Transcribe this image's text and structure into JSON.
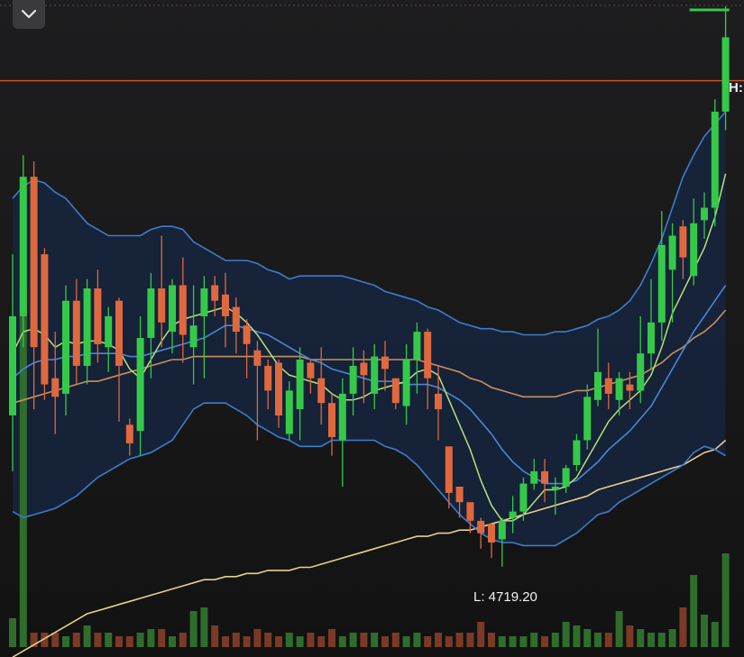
{
  "toolbar": {
    "collapse_icon": "chevron-down-icon"
  },
  "colors": {
    "up": "#35c94a",
    "down": "#e0683e",
    "band_fill": "#16243b",
    "band_outer": "#3d7ccf",
    "mid_band": "#4a86d8",
    "ma_fast": "#b9e07a",
    "ma_slow": "#c8915c",
    "ma_long": "#e8cf8a",
    "resistance_line": "#d0572c",
    "volume_up": "#2f6d2c",
    "volume_down": "#7a3a26"
  },
  "chart_data": {
    "type": "candlestick",
    "x": [
      0,
      1,
      2,
      3,
      4,
      5,
      6,
      7,
      8,
      9,
      10,
      11,
      12,
      13,
      14,
      15,
      16,
      17,
      18,
      19,
      20,
      21,
      22,
      23,
      24,
      25,
      26,
      27,
      28,
      29,
      30,
      31,
      32,
      33,
      34,
      35,
      36,
      37,
      38,
      39,
      40,
      41,
      42,
      43,
      44,
      45,
      46,
      47,
      48,
      49,
      50,
      51,
      52,
      53,
      54,
      55,
      56,
      57,
      58,
      59,
      60,
      61,
      62,
      63,
      64,
      65,
      66,
      67
    ],
    "ohlc": [
      [
        4768,
        4820,
        4750,
        4800
      ],
      [
        4800,
        4852,
        4790,
        4845
      ],
      [
        4845,
        4850,
        4770,
        4790
      ],
      [
        4820,
        4822,
        4773,
        4778
      ],
      [
        4780,
        4795,
        4762,
        4774
      ],
      [
        4775,
        4810,
        4768,
        4805
      ],
      [
        4805,
        4812,
        4778,
        4784
      ],
      [
        4784,
        4812,
        4778,
        4809
      ],
      [
        4809,
        4815,
        4785,
        4791
      ],
      [
        4790,
        4803,
        4782,
        4800
      ],
      [
        4805,
        4806,
        4766,
        4784
      ],
      [
        4765,
        4767,
        4755,
        4759
      ],
      [
        4763,
        4800,
        4755,
        4793
      ],
      [
        4793,
        4814,
        4780,
        4809
      ],
      [
        4809,
        4826,
        4790,
        4798
      ],
      [
        4795,
        4812,
        4788,
        4810
      ],
      [
        4810,
        4819,
        4785,
        4794
      ],
      [
        4790,
        4810,
        4778,
        4797
      ],
      [
        4800,
        4813,
        4780,
        4809
      ],
      [
        4810,
        4813,
        4800,
        4805
      ],
      [
        4807,
        4814,
        4790,
        4800
      ],
      [
        4803,
        4806,
        4788,
        4795
      ],
      [
        4797,
        4799,
        4780,
        4791
      ],
      [
        4789,
        4792,
        4760,
        4784
      ],
      [
        4784,
        4786,
        4770,
        4776
      ],
      [
        4785,
        4786,
        4764,
        4768
      ],
      [
        4762,
        4779,
        4760,
        4776
      ],
      [
        4770,
        4790,
        4760,
        4786
      ],
      [
        4785,
        4786,
        4775,
        4780
      ],
      [
        4780,
        4790,
        4765,
        4772
      ],
      [
        4772,
        4775,
        4755,
        4761
      ],
      [
        4760,
        4780,
        4745,
        4775
      ],
      [
        4775,
        4790,
        4768,
        4784
      ],
      [
        4785,
        4789,
        4772,
        4781
      ],
      [
        4775,
        4791,
        4770,
        4787
      ],
      [
        4787,
        4792,
        4776,
        4783
      ],
      [
        4780,
        4780,
        4770,
        4772
      ],
      [
        4771,
        4791,
        4765,
        4786
      ],
      [
        4786,
        4798,
        4775,
        4795
      ],
      [
        4795,
        4796,
        4770,
        4780
      ],
      [
        4775,
        4784,
        4760,
        4770
      ],
      [
        4758,
        4758,
        4738,
        4743
      ],
      [
        4745,
        4745,
        4735,
        4740
      ],
      [
        4740,
        4740,
        4730,
        4734
      ],
      [
        4734,
        4735,
        4725,
        4730
      ],
      [
        4733,
        4733,
        4722,
        4727
      ],
      [
        4728,
        4735,
        4719.2,
        4734
      ],
      [
        4735,
        4742,
        4730,
        4737
      ],
      [
        4737,
        4748,
        4734,
        4746
      ],
      [
        4746,
        4754,
        4744,
        4750
      ],
      [
        4750,
        4754,
        4740,
        4746
      ],
      [
        4744,
        4748,
        4736,
        4745
      ],
      [
        4745,
        4752,
        4743,
        4751
      ],
      [
        4752,
        4762,
        4750,
        4760
      ],
      [
        4760,
        4778,
        4757,
        4774
      ],
      [
        4773,
        4796,
        4771,
        4782
      ],
      [
        4780,
        4785,
        4770,
        4775
      ],
      [
        4773,
        4782,
        4768,
        4780
      ],
      [
        4778,
        4782,
        4770,
        4776
      ],
      [
        4776,
        4800,
        4772,
        4788
      ],
      [
        4788,
        4812,
        4783,
        4798
      ],
      [
        4798,
        4834,
        4792,
        4823
      ],
      [
        4815,
        4830,
        4798,
        4826
      ],
      [
        4829,
        4831,
        4812,
        4819
      ],
      [
        4813,
        4838,
        4810,
        4830
      ],
      [
        4831,
        4840,
        4825,
        4835
      ],
      [
        4835,
        4870,
        4829,
        4866
      ],
      [
        4866,
        4900,
        4860,
        4890
      ]
    ],
    "volume": [
      8,
      100,
      4,
      4,
      4,
      3,
      4,
      6,
      4,
      4,
      3,
      3,
      4,
      5,
      5,
      3,
      4,
      10,
      11,
      6,
      3,
      4,
      3,
      5,
      4,
      3,
      4,
      3,
      4,
      3,
      5,
      3,
      4,
      4,
      4,
      3,
      4,
      3,
      4,
      3,
      4,
      3,
      4,
      4,
      7,
      4,
      3,
      3,
      3,
      4,
      3,
      4,
      7,
      6,
      5,
      4,
      4,
      10,
      6,
      5,
      4,
      4,
      5,
      11,
      20,
      9,
      7,
      26
    ],
    "ma_fast": [
      4788,
      4795,
      4796,
      4794,
      4790,
      4792,
      4791,
      4792,
      4792,
      4791,
      4789,
      4783,
      4780,
      4786,
      4792,
      4797,
      4799,
      4800,
      4801,
      4802,
      4803,
      4801,
      4798,
      4794,
      4789,
      4784,
      4781,
      4780,
      4779,
      4778,
      4775,
      4773,
      4773,
      4774,
      4776,
      4777,
      4778,
      4779,
      4782,
      4783,
      4781,
      4773,
      4765,
      4757,
      4747,
      4739,
      4734,
      4734,
      4736,
      4740,
      4744,
      4744,
      4745,
      4748,
      4754,
      4760,
      4766,
      4770,
      4773,
      4776,
      4781,
      4790,
      4801,
      4808,
      4815,
      4822,
      4832,
      4846
    ],
    "mid_band": [
      4780,
      4783,
      4785,
      4786,
      4786,
      4787,
      4787,
      4788,
      4788,
      4788,
      4788,
      4787,
      4787,
      4788,
      4789,
      4790,
      4791,
      4792,
      4793,
      4795,
      4797,
      4797,
      4796,
      4795,
      4794,
      4792,
      4790,
      4788,
      4786,
      4785,
      4783,
      4782,
      4781,
      4780,
      4779,
      4779,
      4779,
      4778,
      4778,
      4778,
      4777,
      4775,
      4773,
      4770,
      4766,
      4762,
      4757,
      4753,
      4750,
      4748,
      4746,
      4746,
      4746,
      4747,
      4750,
      4753,
      4757,
      4760,
      4763,
      4767,
      4771,
      4777,
      4783,
      4789,
      4795,
      4800,
      4805,
      4810
    ],
    "band_upper": [
      4838,
      4842,
      4844,
      4843,
      4840,
      4838,
      4834,
      4830,
      4828,
      4826,
      4826,
      4826,
      4826,
      4828,
      4829,
      4829,
      4828,
      4824,
      4822,
      4820,
      4818,
      4818,
      4818,
      4817,
      4815,
      4814,
      4812,
      4813,
      4813,
      4813,
      4813,
      4813,
      4812,
      4811,
      4810,
      4808,
      4807,
      4806,
      4805,
      4803,
      4802,
      4800,
      4798,
      4797,
      4796,
      4796,
      4795,
      4795,
      4794,
      4794,
      4794,
      4795,
      4795,
      4796,
      4797,
      4799,
      4800,
      4802,
      4805,
      4810,
      4817,
      4825,
      4835,
      4845,
      4852,
      4858,
      4862,
      4866
    ],
    "band_lower": [
      4737,
      4735,
      4736,
      4737,
      4738,
      4740,
      4742,
      4745,
      4748,
      4750,
      4752,
      4754,
      4755,
      4756,
      4758,
      4760,
      4765,
      4770,
      4772,
      4772,
      4772,
      4770,
      4768,
      4765,
      4763,
      4761,
      4760,
      4758,
      4758,
      4758,
      4760,
      4760,
      4760,
      4760,
      4760,
      4758,
      4757,
      4755,
      4752,
      4748,
      4744,
      4740,
      4736,
      4733,
      4730,
      4728,
      4727,
      4727,
      4726,
      4726,
      4726,
      4726,
      4728,
      4730,
      4733,
      4736,
      4737,
      4740,
      4742,
      4744,
      4746,
      4748,
      4750,
      4752,
      4756,
      4758,
      4757,
      4755
    ],
    "ma_slow": [
      4772,
      4773,
      4774,
      4775,
      4776,
      4777,
      4778,
      4779,
      4779,
      4780,
      4781,
      4782,
      4783,
      4784,
      4785,
      4786,
      4786,
      4787,
      4787,
      4787,
      4787,
      4787,
      4787,
      4787,
      4787,
      4787,
      4787,
      4787,
      4786,
      4786,
      4786,
      4786,
      4786,
      4786,
      4786,
      4786,
      4786,
      4786,
      4786,
      4785,
      4784,
      4783,
      4782,
      4780,
      4779,
      4777,
      4776,
      4775,
      4774,
      4774,
      4774,
      4774,
      4775,
      4776,
      4776,
      4777,
      4778,
      4779,
      4780,
      4781,
      4783,
      4785,
      4788,
      4790,
      4793,
      4795,
      4798,
      4802
    ],
    "ma_long": [
      4690,
      4692,
      4694,
      4696,
      4698,
      4700,
      4702,
      4704,
      4705,
      4706,
      4707,
      4708,
      4709,
      4710,
      4711,
      4712,
      4713,
      4714,
      4715,
      4715,
      4716,
      4716,
      4717,
      4717,
      4718,
      4718,
      4718,
      4719,
      4719,
      4720,
      4721,
      4722,
      4723,
      4724,
      4725,
      4726,
      4727,
      4728,
      4729,
      4729,
      4730,
      4730,
      4731,
      4731,
      4732,
      4733,
      4734,
      4735,
      4736,
      4737,
      4738,
      4739,
      4740,
      4741,
      4742,
      4744,
      4745,
      4746,
      4747,
      4748,
      4749,
      4750,
      4751,
      4752,
      4754,
      4756,
      4757,
      4760
    ],
    "resistance": 4876,
    "low_label": "L: 4719.20",
    "high_label": "H:",
    "ylim": [
      4695,
      4900
    ]
  }
}
